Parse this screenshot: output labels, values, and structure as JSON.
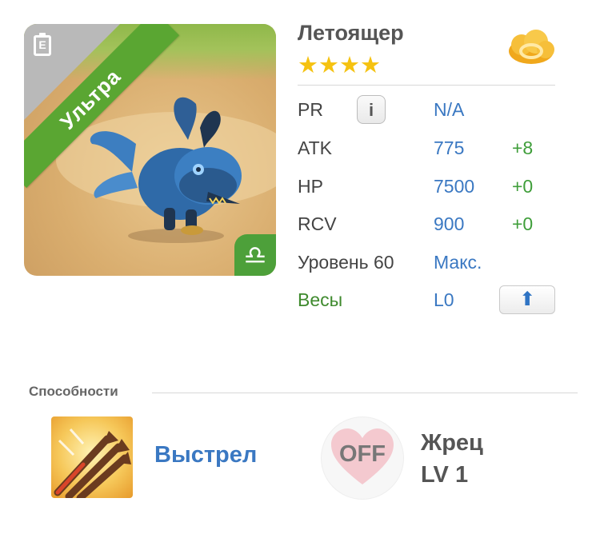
{
  "monster": {
    "rarity_ribbon": "Ультра",
    "name": "Летоящер",
    "stars": "★★★★",
    "star_count": 4,
    "element_icon": "libra-icon",
    "element_glyph": "♎",
    "clipboard_glyph": "E"
  },
  "stats": [
    {
      "label": "PR",
      "value": "N/A",
      "bonus": "",
      "info_glyph": "i"
    },
    {
      "label": "ATK",
      "value": "775",
      "bonus": "+8"
    },
    {
      "label": "HP",
      "value": "7500",
      "bonus": "+0"
    },
    {
      "label": "RCV",
      "value": "900",
      "bonus": "+0"
    },
    {
      "label": "Уровень 60",
      "value": "Макс.",
      "bonus": ""
    },
    {
      "label": "Весы",
      "value": "L0",
      "bonus": "",
      "button_glyph": "⬆"
    }
  ],
  "abilities": {
    "section_title": "Способности",
    "skill_name": "Выстрел",
    "leader_state": "OFF",
    "leader_name": "Жрец",
    "leader_level": "LV 1"
  },
  "colors": {
    "accent_blue": "#3a78c2",
    "bonus_green": "#3f9e3a",
    "ribbon_green": "#5aa632",
    "star_gold": "#f5c211"
  }
}
